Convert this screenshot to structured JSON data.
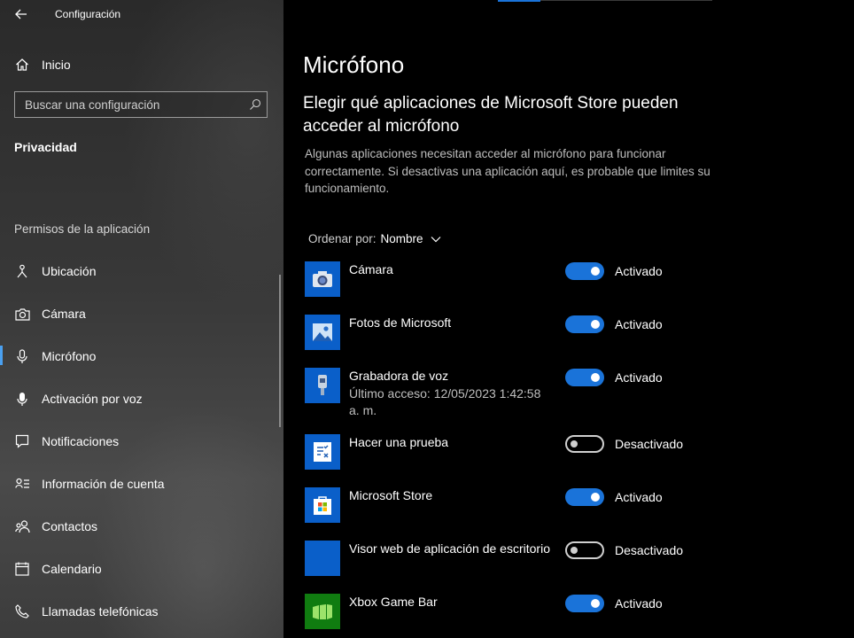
{
  "window": {
    "title": "Configuración"
  },
  "sidebar": {
    "home_label": "Inicio",
    "search_placeholder": "Buscar una configuración",
    "category": "Privacidad",
    "section_header": "Permisos de la aplicación",
    "items": [
      {
        "label": "Ubicación",
        "icon": "location-icon"
      },
      {
        "label": "Cámara",
        "icon": "camera-icon"
      },
      {
        "label": "Micrófono",
        "icon": "microphone-icon",
        "selected": true
      },
      {
        "label": "Activación por voz",
        "icon": "voice-activation-icon"
      },
      {
        "label": "Notificaciones",
        "icon": "notifications-icon"
      },
      {
        "label": "Información de cuenta",
        "icon": "account-info-icon"
      },
      {
        "label": "Contactos",
        "icon": "contacts-icon"
      },
      {
        "label": "Calendario",
        "icon": "calendar-icon"
      },
      {
        "label": "Llamadas telefónicas",
        "icon": "phone-calls-icon"
      }
    ]
  },
  "main": {
    "title": "Micrófono",
    "subtitle": "Elegir qué aplicaciones de Microsoft Store pueden acceder al micrófono",
    "description": "Algunas aplicaciones necesitan acceder al micrófono para funcionar correctamente. Si desactivas una aplicación aquí, es probable que limites su funcionamiento.",
    "sort_label": "Ordenar por:",
    "sort_value": "Nombre",
    "apps": [
      {
        "name": "Cámara",
        "state": "Activado",
        "on": true,
        "icon": "camera-app-icon"
      },
      {
        "name": "Fotos de Microsoft",
        "state": "Activado",
        "on": true,
        "icon": "photos-app-icon"
      },
      {
        "name": "Grabadora de voz",
        "sub": "Último acceso: 12/05/2023 1:42:58 a. m.",
        "state": "Activado",
        "on": true,
        "icon": "voice-recorder-app-icon"
      },
      {
        "name": "Hacer una prueba",
        "state": "Desactivado",
        "on": false,
        "icon": "take-a-test-app-icon"
      },
      {
        "name": "Microsoft Store",
        "state": "Activado",
        "on": true,
        "icon": "store-app-icon"
      },
      {
        "name": "Visor web de aplicación de escritorio",
        "state": "Desactivado",
        "on": false,
        "icon": "web-viewer-app-icon"
      },
      {
        "name": "Xbox Game Bar",
        "state": "Activado",
        "on": true,
        "icon": "xbox-game-bar-app-icon"
      }
    ]
  },
  "colors": {
    "accent": "#1a73d9",
    "tile": "#0a5fc9",
    "background": "#000000"
  }
}
